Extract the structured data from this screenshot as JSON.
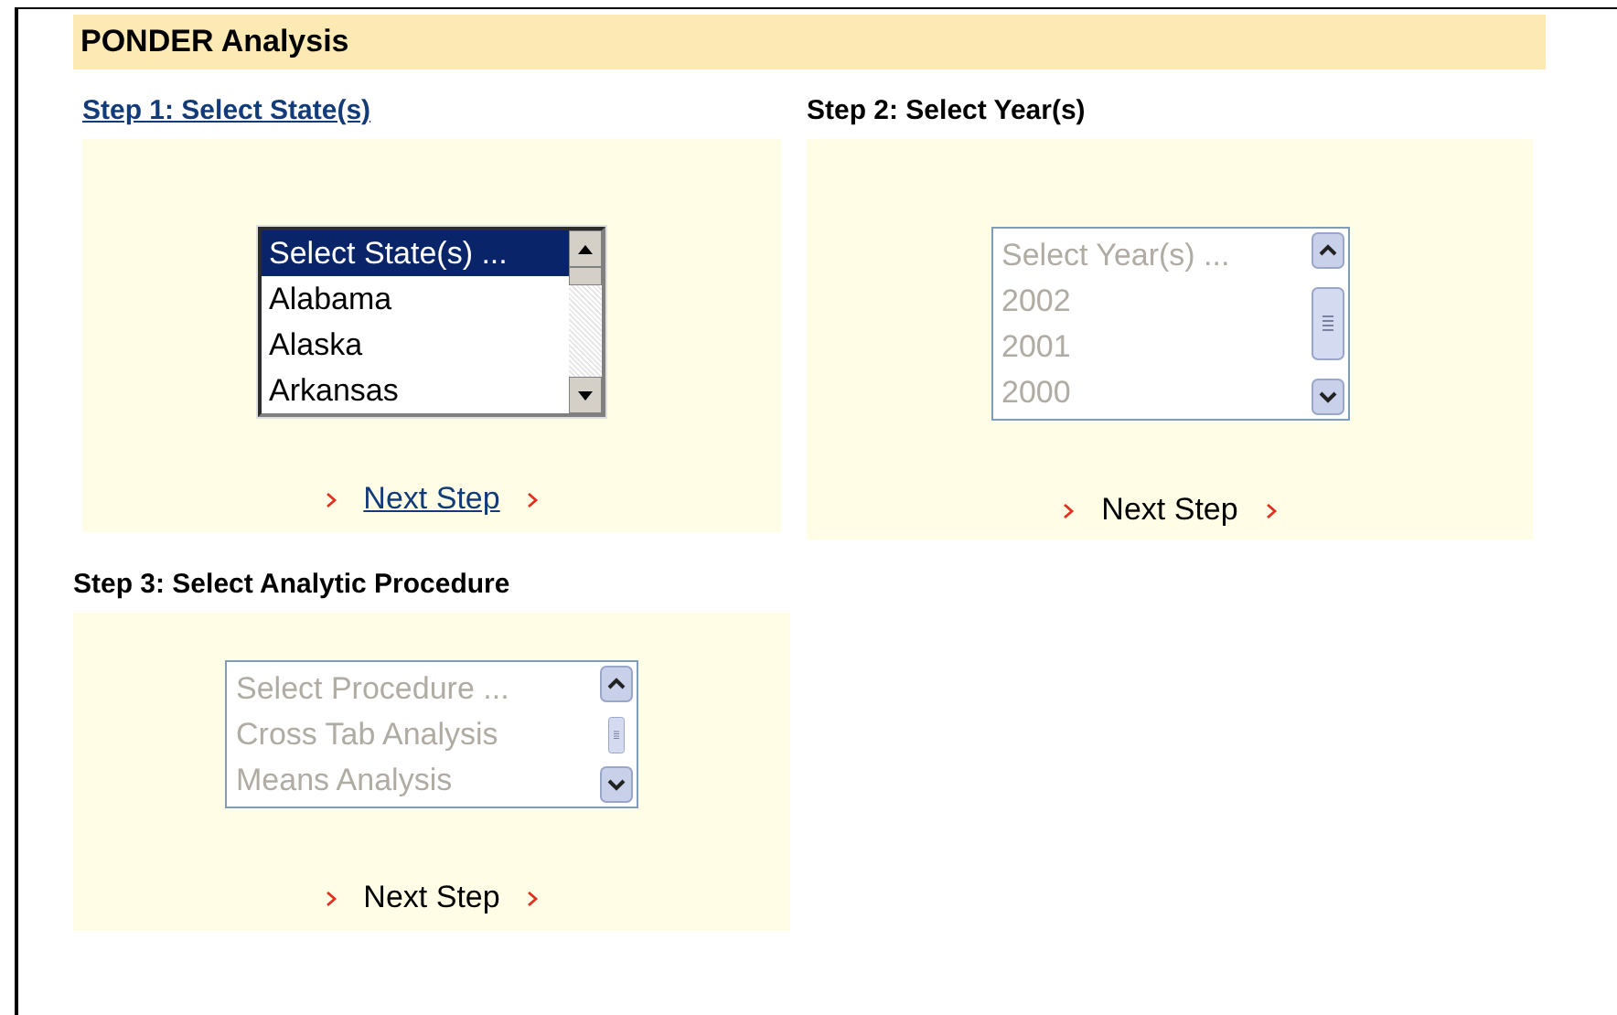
{
  "header": {
    "title": "PONDER Analysis"
  },
  "steps": [
    {
      "title": "Step 1: Select State(s)",
      "title_link": true,
      "disabled": false,
      "next_step": {
        "label": "Next Step",
        "link": true
      },
      "options": [
        {
          "label": "Select State(s) ...",
          "selected": true
        },
        {
          "label": "Alabama",
          "selected": false
        },
        {
          "label": "Alaska",
          "selected": false
        },
        {
          "label": "Arkansas",
          "selected": false
        }
      ]
    },
    {
      "title": "Step 2: Select Year(s)",
      "title_link": false,
      "disabled": true,
      "next_step": {
        "label": "Next Step",
        "link": false
      },
      "options": [
        {
          "label": "Select Year(s) ...",
          "selected": false
        },
        {
          "label": "2002",
          "selected": false
        },
        {
          "label": "2001",
          "selected": false
        },
        {
          "label": "2000",
          "selected": false
        }
      ]
    },
    {
      "title": "Step 3: Select Analytic Procedure",
      "title_link": false,
      "disabled": true,
      "next_step": {
        "label": "Next Step",
        "link": false
      },
      "options": [
        {
          "label": "Select Procedure ...",
          "selected": false
        },
        {
          "label": "Cross Tab Analysis",
          "selected": false
        },
        {
          "label": "Means Analysis",
          "selected": false
        }
      ]
    }
  ]
}
